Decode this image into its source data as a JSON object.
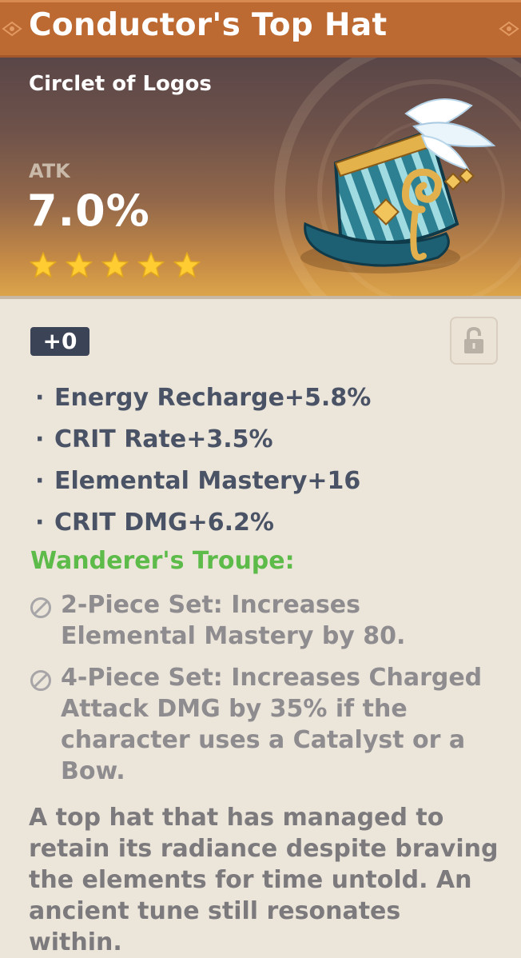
{
  "artifact": {
    "name": "Conductor's Top Hat",
    "slot": "Circlet of Logos",
    "main_stat": {
      "name": "ATK",
      "value": "7.0%"
    },
    "rarity_stars": 5,
    "level": "+0",
    "locked": false
  },
  "substats": [
    "Energy Recharge+5.8%",
    "CRIT Rate+3.5%",
    "Elemental Mastery+16",
    "CRIT DMG+6.2%"
  ],
  "substat_bullet": "·",
  "set": {
    "name": "Wanderer's Troupe:",
    "bonus_2": "2-Piece Set: Increases Elemental Mastery by 80.",
    "bonus_4": "4-Piece Set: Increases Charged Attack DMG by 35% if the character uses a Catalyst or a Bow."
  },
  "description": "A top hat that has managed to retain its radiance despite braving the elements for time untold. An ancient tune still resonates within.",
  "icons": {
    "star": "star-icon",
    "lock": "unlock-icon",
    "set_inactive": "ban-icon",
    "artifact": "top-hat-icon"
  },
  "colors": {
    "title_bar": "#bc6932",
    "star": "#ffcc32",
    "set_name": "#5dbb4a",
    "level_badge": "#3b4356",
    "substat_text": "#4a5366"
  }
}
